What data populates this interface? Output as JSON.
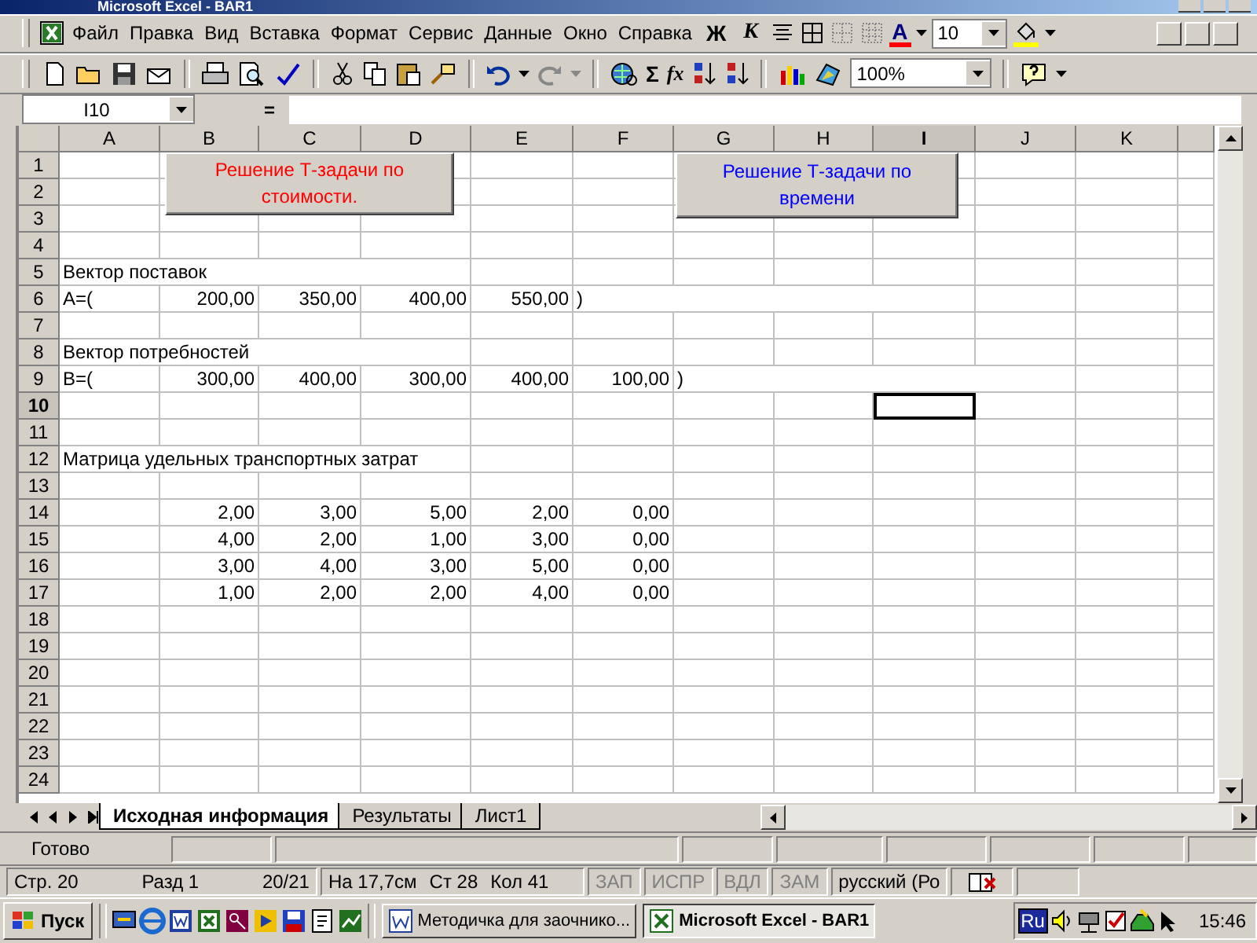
{
  "window": {
    "title": "Microsoft Excel - BAR1"
  },
  "menu": [
    {
      "label": "Файл"
    },
    {
      "label": "Правка"
    },
    {
      "label": "Вид"
    },
    {
      "label": "Вставка"
    },
    {
      "label": "Формат"
    },
    {
      "label": "Сервис"
    },
    {
      "label": "Данные"
    },
    {
      "label": "Окно"
    },
    {
      "label": "Справка"
    }
  ],
  "format_toolbar": {
    "bold": "Ж",
    "italic": "К",
    "font_color": "А",
    "font_size": "10"
  },
  "standard_toolbar": {
    "sum": "Σ",
    "function": "fx",
    "zoom": "100%"
  },
  "formula_bar": {
    "name_box": "I10",
    "equals": "="
  },
  "columns": [
    {
      "label": "A",
      "selected": false
    },
    {
      "label": "B",
      "selected": false
    },
    {
      "label": "C",
      "selected": false
    },
    {
      "label": "D",
      "selected": false
    },
    {
      "label": "E",
      "selected": false
    },
    {
      "label": "F",
      "selected": false
    },
    {
      "label": "G",
      "selected": false
    },
    {
      "label": "H",
      "selected": false
    },
    {
      "label": "I",
      "selected": true
    },
    {
      "label": "J",
      "selected": false
    },
    {
      "label": "K",
      "selected": false
    }
  ],
  "rows": [
    {
      "label": "1",
      "selected": false,
      "cells": []
    },
    {
      "label": "2",
      "selected": false,
      "cells": []
    },
    {
      "label": "3",
      "selected": false,
      "cells": []
    },
    {
      "label": "4",
      "selected": false,
      "cells": []
    },
    {
      "label": "5",
      "selected": false,
      "cells": [
        {
          "kind": "text",
          "text": "Вектор поставок"
        }
      ]
    },
    {
      "label": "6",
      "selected": false,
      "cells": [
        {
          "kind": "text",
          "text": "A=("
        },
        {
          "kind": "number",
          "text": "200,00"
        },
        {
          "kind": "number",
          "text": "350,00"
        },
        {
          "kind": "number",
          "text": "400,00"
        },
        {
          "kind": "number",
          "text": "550,00"
        },
        {
          "kind": "text",
          "text": ")"
        }
      ]
    },
    {
      "label": "7",
      "selected": false,
      "cells": []
    },
    {
      "label": "8",
      "selected": false,
      "cells": [
        {
          "kind": "text",
          "text": "Вектор потребностей"
        }
      ]
    },
    {
      "label": "9",
      "selected": false,
      "cells": [
        {
          "kind": "text",
          "text": "B=("
        },
        {
          "kind": "number",
          "text": "300,00"
        },
        {
          "kind": "number",
          "text": "400,00"
        },
        {
          "kind": "number",
          "text": "300,00"
        },
        {
          "kind": "number",
          "text": "400,00"
        },
        {
          "kind": "number",
          "text": "100,00"
        },
        {
          "kind": "text",
          "text": ")"
        }
      ]
    },
    {
      "label": "10",
      "selected": true,
      "cells": [
        null,
        null,
        null,
        null,
        null,
        null,
        null,
        null,
        {
          "kind": "empty",
          "selected": true
        }
      ]
    },
    {
      "label": "11",
      "selected": false,
      "cells": []
    },
    {
      "label": "12",
      "selected": false,
      "cells": [
        {
          "kind": "text",
          "text": "Матрица удельных транспортных затрат"
        }
      ]
    },
    {
      "label": "13",
      "selected": false,
      "cells": []
    },
    {
      "label": "14",
      "selected": false,
      "cells": [
        null,
        {
          "kind": "number",
          "text": "2,00"
        },
        {
          "kind": "number",
          "text": "3,00"
        },
        {
          "kind": "number",
          "text": "5,00"
        },
        {
          "kind": "number",
          "text": "2,00"
        },
        {
          "kind": "number",
          "text": "0,00"
        }
      ]
    },
    {
      "label": "15",
      "selected": false,
      "cells": [
        null,
        {
          "kind": "number",
          "text": "4,00"
        },
        {
          "kind": "number",
          "text": "2,00"
        },
        {
          "kind": "number",
          "text": "1,00"
        },
        {
          "kind": "number",
          "text": "3,00"
        },
        {
          "kind": "number",
          "text": "0,00"
        }
      ]
    },
    {
      "label": "16",
      "selected": false,
      "cells": [
        null,
        {
          "kind": "number",
          "text": "3,00"
        },
        {
          "kind": "number",
          "text": "4,00"
        },
        {
          "kind": "number",
          "text": "3,00"
        },
        {
          "kind": "number",
          "text": "5,00"
        },
        {
          "kind": "number",
          "text": "0,00"
        }
      ]
    },
    {
      "label": "17",
      "selected": false,
      "cells": [
        null,
        {
          "kind": "number",
          "text": "1,00"
        },
        {
          "kind": "number",
          "text": "2,00"
        },
        {
          "kind": "number",
          "text": "2,00"
        },
        {
          "kind": "number",
          "text": "4,00"
        },
        {
          "kind": "number",
          "text": "0,00"
        }
      ]
    },
    {
      "label": "18",
      "selected": false,
      "cells": []
    },
    {
      "label": "19",
      "selected": false,
      "cells": []
    },
    {
      "label": "20",
      "selected": false,
      "cells": []
    },
    {
      "label": "21",
      "selected": false,
      "cells": []
    },
    {
      "label": "22",
      "selected": false,
      "cells": []
    },
    {
      "label": "23",
      "selected": false,
      "cells": []
    },
    {
      "label": "24",
      "selected": false,
      "cells": []
    }
  ],
  "sheet_buttons": [
    {
      "label": "Решение Т-задачи по стоимости.",
      "color": "#ff0000"
    },
    {
      "label": "Решение Т-задачи по времени",
      "color": "#0000ff"
    }
  ],
  "sheet_tabs": [
    {
      "label": "Исходная информация",
      "selected": true
    },
    {
      "label": "Результаты",
      "selected": false
    },
    {
      "label": "Лист1",
      "selected": false
    }
  ],
  "status_bar": {
    "text": "Готово"
  },
  "word_status_bar": {
    "fields": [
      "Стр. 20",
      "Разд 1",
      "20/21",
      "На 17,7см",
      "Ст 28",
      "Кол 41"
    ],
    "flags": [
      {
        "label": "ЗАП",
        "disabled": true
      },
      {
        "label": "ИСПР",
        "disabled": true
      },
      {
        "label": "ВДЛ",
        "disabled": true
      },
      {
        "label": "ЗАМ",
        "disabled": true
      }
    ],
    "language": "русский (Ро"
  },
  "taskbar": {
    "start": "Пуск",
    "tasks": [
      {
        "label": "Методичка для заочнико...",
        "selected": false
      },
      {
        "label": "Microsoft Excel - BAR1",
        "selected": true
      }
    ],
    "language": "Ru",
    "clock": "15:46"
  }
}
